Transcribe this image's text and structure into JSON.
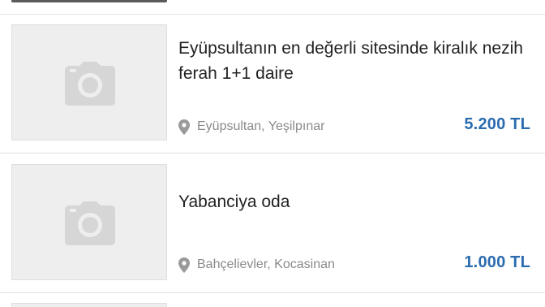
{
  "listings": [
    {
      "title": "Eyüpsultanın en değerli sitesinde kiralık nezih ferah 1+1 daire",
      "location": "Eyüpsultan, Yeşilpınar",
      "price": "5.200 TL",
      "thumbnail_icon": "camera-icon",
      "location_icon": "map-pin-icon"
    },
    {
      "title": "Yabanciya oda",
      "location": "Bahçelievler, Kocasinan",
      "price": "1.000 TL",
      "thumbnail_icon": "camera-icon",
      "location_icon": "map-pin-icon"
    }
  ],
  "colors": {
    "price": "#2b6cb0",
    "title": "#222222",
    "location": "#8a8a8a",
    "placeholder_bg": "#eeeeee",
    "divider": "#e3e3e3"
  }
}
